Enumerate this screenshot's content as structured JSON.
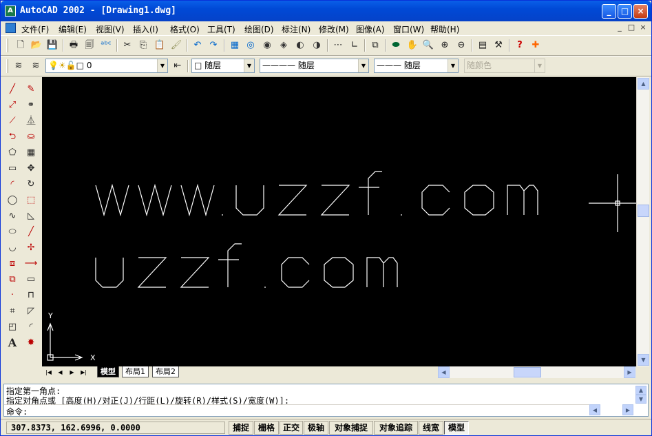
{
  "window": {
    "title": "AutoCAD 2002 - [Drawing1.dwg]",
    "app_icon": "autocad-icon",
    "buttons": [
      "minimize",
      "maximize",
      "close"
    ]
  },
  "menu": {
    "items": [
      "文件(F)",
      "编辑(E)",
      "视图(V)",
      "插入(I)",
      "格式(O)",
      "工具(T)",
      "绘图(D)",
      "标注(N)",
      "修改(M)",
      "图像(A)",
      "窗口(W)",
      "帮助(H)"
    ],
    "mdi_buttons": [
      "_",
      "□",
      "×"
    ]
  },
  "layers_bar": {
    "layer_value": "0",
    "color_value": "随层",
    "linetype_value": "———— 随层",
    "lineweight_value": "——— 随层",
    "plotstyle_value": "随颜色"
  },
  "drawing": {
    "text_line1": "www.uzzf.com",
    "text_line2": "uzzf.com",
    "ucs_x": "X",
    "ucs_y": "Y"
  },
  "layout_tabs": [
    "模型",
    "布局1",
    "布局2"
  ],
  "command": {
    "line1": "指定第一角点:",
    "line2": "指定对角点或 [高度(H)/对正(J)/行距(L)/旋转(R)/样式(S)/宽度(W)]:",
    "prompt": "命令:"
  },
  "status": {
    "coords": "307.8373, 162.6996, 0.0000",
    "buttons": [
      "捕捉",
      "栅格",
      "正交",
      "极轴",
      "对象捕捉",
      "对象追踪",
      "线宽",
      "模型"
    ]
  }
}
